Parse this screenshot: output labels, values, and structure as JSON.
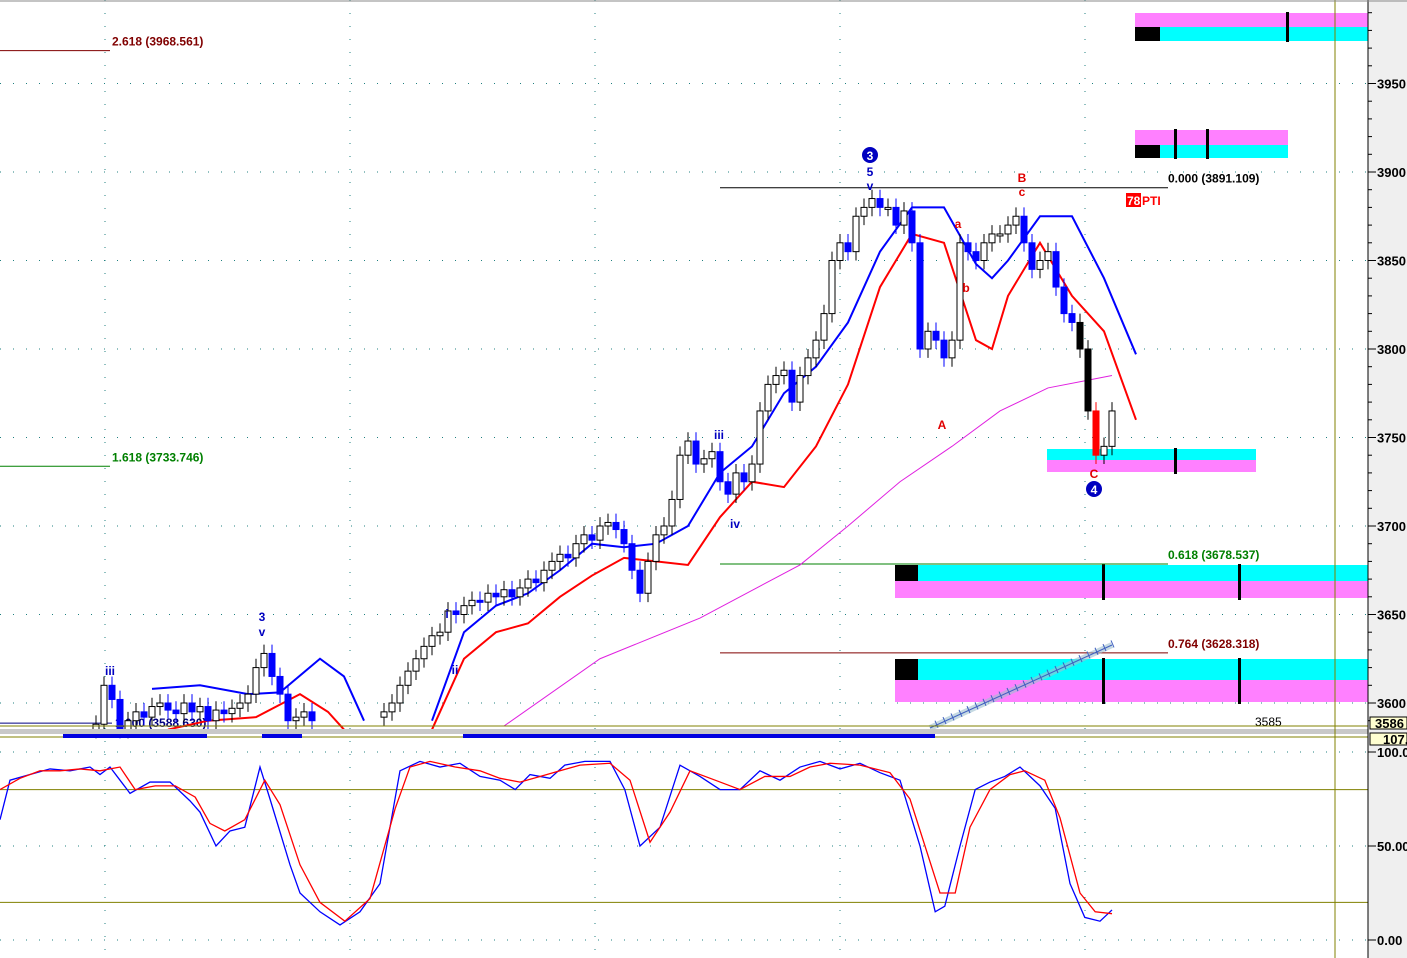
{
  "chart_data": {
    "type": "candlestick",
    "price_axis": {
      "ticks": [
        3950,
        3900,
        3850,
        3800,
        3750,
        3700,
        3650,
        3600
      ],
      "ylim": [
        3586,
        3990
      ],
      "current_label": "3586"
    },
    "osc_axis": {
      "ticks": [
        "100.0",
        "50.00",
        "0.00"
      ],
      "ylim": [
        0,
        107
      ],
      "current_label": "107.",
      "levels": [
        80,
        20
      ]
    },
    "candles": [
      {
        "start": 12,
        "closes": [
          3588,
          3610,
          3602,
          3585,
          3590,
          3595,
          3592,
          3598,
          3600,
          3596,
          3594,
          3600,
          3595,
          3598,
          3590,
          3596,
          3594,
          3597,
          3600,
          3605,
          3620,
          3628,
          3615,
          3605,
          3590,
          3592,
          3595,
          3590
        ]
      },
      {
        "start": 48,
        "closes": [
          3595,
          3600,
          3610,
          3618,
          3625,
          3632,
          3638,
          3640,
          3652,
          3650,
          3655,
          3658,
          3657,
          3662,
          3660,
          3664,
          3660,
          3665,
          3670,
          3668,
          3675,
          3680,
          3684,
          3682,
          3690,
          3695,
          3692,
          3700,
          3702,
          3698,
          3690,
          3675,
          3662,
          3680,
          3695,
          3700,
          3715,
          3740,
          3748,
          3735,
          3738,
          3742,
          3725,
          3718,
          3730,
          3725,
          3735,
          3765,
          3780,
          3785,
          3788,
          3770,
          3785,
          3795,
          3805,
          3820,
          3850,
          3860,
          3855,
          3875,
          3880,
          3885,
          3880,
          3880,
          3870,
          3878,
          3860,
          3800,
          3810,
          3805,
          3795,
          3805,
          3860,
          3855,
          3850,
          3860,
          3865,
          3865,
          3870,
          3875,
          3860,
          3845,
          3850,
          3855,
          3835,
          3820,
          3815,
          3800,
          3765,
          3740,
          3745,
          3765
        ]
      }
    ],
    "lines": [
      {
        "name": "upper-band",
        "color": "#0000ff",
        "segments": [
          [
            [
              19,
              3608
            ],
            [
              25,
              3610
            ],
            [
              31,
              3605
            ],
            [
              35,
              3606
            ],
            [
              40,
              3625
            ],
            [
              43,
              3615
            ],
            [
              45.5,
              3590
            ]
          ],
          [
            [
              54,
              3590
            ],
            [
              58,
              3640
            ],
            [
              62,
              3655
            ],
            [
              66,
              3662
            ],
            [
              70,
              3675
            ],
            [
              74,
              3690
            ],
            [
              78,
              3688
            ],
            [
              82,
              3690
            ],
            [
              86,
              3700
            ],
            [
              90,
              3730
            ],
            [
              94,
              3745
            ],
            [
              98,
              3775
            ],
            [
              102,
              3790
            ],
            [
              106,
              3815
            ],
            [
              110,
              3855
            ],
            [
              114,
              3880
            ],
            [
              118,
              3880
            ],
            [
              122,
              3848
            ],
            [
              124,
              3840
            ],
            [
              126,
              3850
            ],
            [
              130,
              3875
            ],
            [
              134,
              3875
            ],
            [
              138,
              3840
            ],
            [
              142,
              3797
            ]
          ]
        ]
      },
      {
        "name": "lower-band",
        "color": "#ff0000",
        "segments": [
          [
            [
              21,
              3585
            ],
            [
              26,
              3590
            ],
            [
              32,
              3592
            ],
            [
              37.5,
              3605
            ],
            [
              41,
              3595
            ],
            [
              43,
              3585
            ]
          ],
          [
            [
              54,
              3585
            ],
            [
              58,
              3625
            ],
            [
              62,
              3640
            ],
            [
              66,
              3645
            ],
            [
              70,
              3660
            ],
            [
              74,
              3672
            ],
            [
              78,
              3682
            ],
            [
              82,
              3680
            ],
            [
              86,
              3678
            ],
            [
              90,
              3705
            ],
            [
              94,
              3725
            ],
            [
              98,
              3722
            ],
            [
              102,
              3745
            ],
            [
              106,
              3780
            ],
            [
              110,
              3835
            ],
            [
              114,
              3865
            ],
            [
              118,
              3860
            ],
            [
              122,
              3805
            ],
            [
              124,
              3800
            ],
            [
              126,
              3830
            ],
            [
              130,
              3860
            ],
            [
              134,
              3830
            ],
            [
              138,
              3810
            ],
            [
              142,
              3760
            ]
          ]
        ]
      },
      {
        "name": "moving-average",
        "color": "#e020e0",
        "segments": [
          [
            [
              63,
              3587
            ],
            [
              75,
              3625
            ],
            [
              87.5,
              3648
            ],
            [
              100,
              3678
            ],
            [
              106,
              3700
            ],
            [
              112.5,
              3725
            ],
            [
              119,
              3745
            ],
            [
              125,
              3765
            ],
            [
              131,
              3778
            ],
            [
              139,
              3785
            ]
          ]
        ]
      }
    ],
    "stochastic": [
      {
        "name": "fast",
        "color": "#0000ff",
        "points": [
          [
            0,
            64
          ],
          [
            1.25,
            85
          ],
          [
            3.75,
            88
          ],
          [
            6.25,
            91
          ],
          [
            8.75,
            90
          ],
          [
            11.25,
            92
          ],
          [
            12.5,
            88
          ],
          [
            13.75,
            92
          ],
          [
            15,
            85
          ],
          [
            16.25,
            78
          ],
          [
            18.75,
            84
          ],
          [
            21.25,
            84
          ],
          [
            23.75,
            74
          ],
          [
            25,
            68
          ],
          [
            27,
            50
          ],
          [
            28.75,
            58
          ],
          [
            30.6,
            60
          ],
          [
            32.5,
            92
          ],
          [
            33.75,
            75
          ],
          [
            36.25,
            40
          ],
          [
            37.5,
            25
          ],
          [
            40,
            15
          ],
          [
            42.5,
            8
          ],
          [
            45,
            15
          ],
          [
            47.5,
            30
          ],
          [
            50,
            90
          ],
          [
            52.5,
            95
          ],
          [
            55,
            92
          ],
          [
            57.5,
            94
          ],
          [
            60,
            87
          ],
          [
            62.5,
            85
          ],
          [
            64.4,
            80
          ],
          [
            66.25,
            88
          ],
          [
            68.75,
            86
          ],
          [
            70.6,
            93
          ],
          [
            73.1,
            95
          ],
          [
            76.25,
            95
          ],
          [
            78.1,
            80
          ],
          [
            80,
            50
          ],
          [
            82.5,
            60
          ],
          [
            85,
            93
          ],
          [
            87.5,
            87
          ],
          [
            90,
            80
          ],
          [
            92.5,
            80
          ],
          [
            95,
            90
          ],
          [
            97.5,
            85
          ],
          [
            100,
            92
          ],
          [
            102.5,
            95
          ],
          [
            105,
            91
          ],
          [
            107.5,
            94
          ],
          [
            110,
            89
          ],
          [
            112.5,
            85
          ],
          [
            115,
            50
          ],
          [
            116.9,
            15
          ],
          [
            118.1,
            18
          ],
          [
            120,
            50
          ],
          [
            121.9,
            80
          ],
          [
            123.75,
            84
          ],
          [
            125.6,
            87
          ],
          [
            127.5,
            92
          ],
          [
            130,
            82
          ],
          [
            131.9,
            70
          ],
          [
            133.75,
            30
          ],
          [
            135.6,
            12
          ],
          [
            137.5,
            10
          ],
          [
            139,
            16
          ]
        ]
      },
      {
        "name": "slow",
        "color": "#ff0000",
        "points": [
          [
            0,
            80
          ],
          [
            2.5,
            86
          ],
          [
            5,
            90
          ],
          [
            7.5,
            90
          ],
          [
            10,
            91
          ],
          [
            12.5,
            90
          ],
          [
            15,
            92
          ],
          [
            16.9,
            80
          ],
          [
            19.4,
            82
          ],
          [
            21.9,
            82
          ],
          [
            24.4,
            76
          ],
          [
            26.25,
            62
          ],
          [
            28.1,
            58
          ],
          [
            30.6,
            64
          ],
          [
            33.1,
            85
          ],
          [
            35,
            72
          ],
          [
            37.5,
            40
          ],
          [
            40,
            20
          ],
          [
            43.1,
            10
          ],
          [
            46.25,
            22
          ],
          [
            49.4,
            70
          ],
          [
            51.25,
            92
          ],
          [
            53.75,
            95
          ],
          [
            56.9,
            92
          ],
          [
            60,
            90
          ],
          [
            62.5,
            86
          ],
          [
            65,
            84
          ],
          [
            67.5,
            87
          ],
          [
            70,
            90
          ],
          [
            72.5,
            93
          ],
          [
            76.25,
            94
          ],
          [
            78.75,
            85
          ],
          [
            81.25,
            52
          ],
          [
            83.75,
            68
          ],
          [
            86.25,
            90
          ],
          [
            89.4,
            85
          ],
          [
            92.5,
            80
          ],
          [
            95.6,
            87
          ],
          [
            98.75,
            87
          ],
          [
            101.25,
            92
          ],
          [
            103.75,
            94
          ],
          [
            107.5,
            93
          ],
          [
            111.25,
            89
          ],
          [
            113.75,
            75
          ],
          [
            117.5,
            25
          ],
          [
            119.4,
            25
          ],
          [
            121.25,
            60
          ],
          [
            123.75,
            80
          ],
          [
            126.25,
            88
          ],
          [
            128.1,
            90
          ],
          [
            130.6,
            85
          ],
          [
            132.5,
            65
          ],
          [
            135,
            25
          ],
          [
            136.9,
            15
          ],
          [
            139,
            14
          ]
        ]
      }
    ],
    "fib_levels": [
      {
        "label": "2.618 (3968.561)",
        "price": 3968.561,
        "color": "#800000"
      },
      {
        "label": "1.618 (3733.746)",
        "price": 3733.746,
        "color": "#008000"
      },
      {
        "label": "1.000 (3588.630)",
        "price": 3588.63,
        "color": "#000080"
      },
      {
        "label": "0.000 (3891.109)",
        "price": 3891.109,
        "color": "#000000"
      },
      {
        "label": "0.618 (3678.537)",
        "price": 3678.537,
        "color": "#008000"
      },
      {
        "label": "0.764 (3628.318)",
        "price": 3628.318,
        "color": "#800000"
      }
    ],
    "wave_labels": [
      {
        "text": "3",
        "circled": true,
        "color": "#0000c0"
      },
      {
        "text": "5",
        "color": "#0000c0"
      },
      {
        "text": "v",
        "color": "#0000c0"
      },
      {
        "text": "B",
        "color": "#e00000"
      },
      {
        "text": "c",
        "color": "#e00000"
      },
      {
        "text": "a",
        "color": "#e00000"
      },
      {
        "text": "b",
        "color": "#e00000"
      },
      {
        "text": "A",
        "color": "#e00000"
      },
      {
        "text": "C",
        "color": "#e00000"
      },
      {
        "text": "4",
        "circled": true,
        "color": "#0000c0"
      },
      {
        "text": "iii",
        "color": "#0000c0"
      },
      {
        "text": "iv",
        "color": "#0000c0"
      },
      {
        "text": "i",
        "color": "#0000c0"
      },
      {
        "text": "ii",
        "color": "#0000c0"
      },
      {
        "text": "3",
        "color": "#0000c0"
      },
      {
        "text": "v",
        "color": "#0000c0"
      },
      {
        "text": "iii",
        "color": "#0000c0"
      }
    ],
    "annotations": {
      "pti_number": "78",
      "pti_text": "PTI",
      "low_label": "3585"
    }
  }
}
